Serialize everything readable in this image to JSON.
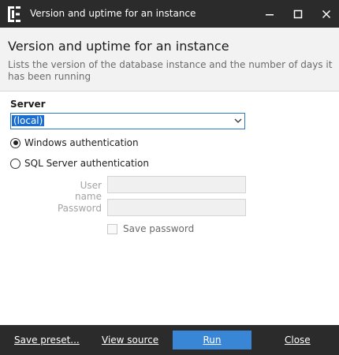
{
  "window": {
    "title": "Version and uptime for an instance"
  },
  "header": {
    "title": "Version and uptime for an instance",
    "description": "Lists the version of the database instance and the number of days it has been running"
  },
  "server": {
    "label": "Server",
    "selected": "(local)"
  },
  "auth": {
    "windows_label": "Windows authentication",
    "sql_label": "SQL Server authentication",
    "selected": "windows"
  },
  "credentials": {
    "username_label": "User name",
    "password_label": "Password",
    "username_value": "",
    "password_value": "",
    "save_password_label": "Save password",
    "save_password_checked": false
  },
  "footer": {
    "save_preset": "Save preset...",
    "view_source": "View source",
    "run": "Run",
    "close": "Close"
  },
  "colors": {
    "titlebar": "#2b2b2b",
    "accent": "#3a86d6",
    "selection": "#1c6fd1"
  },
  "icons": [
    "app-logo-icon",
    "minimize-icon",
    "maximize-icon",
    "close-icon",
    "chevron-down-icon"
  ]
}
